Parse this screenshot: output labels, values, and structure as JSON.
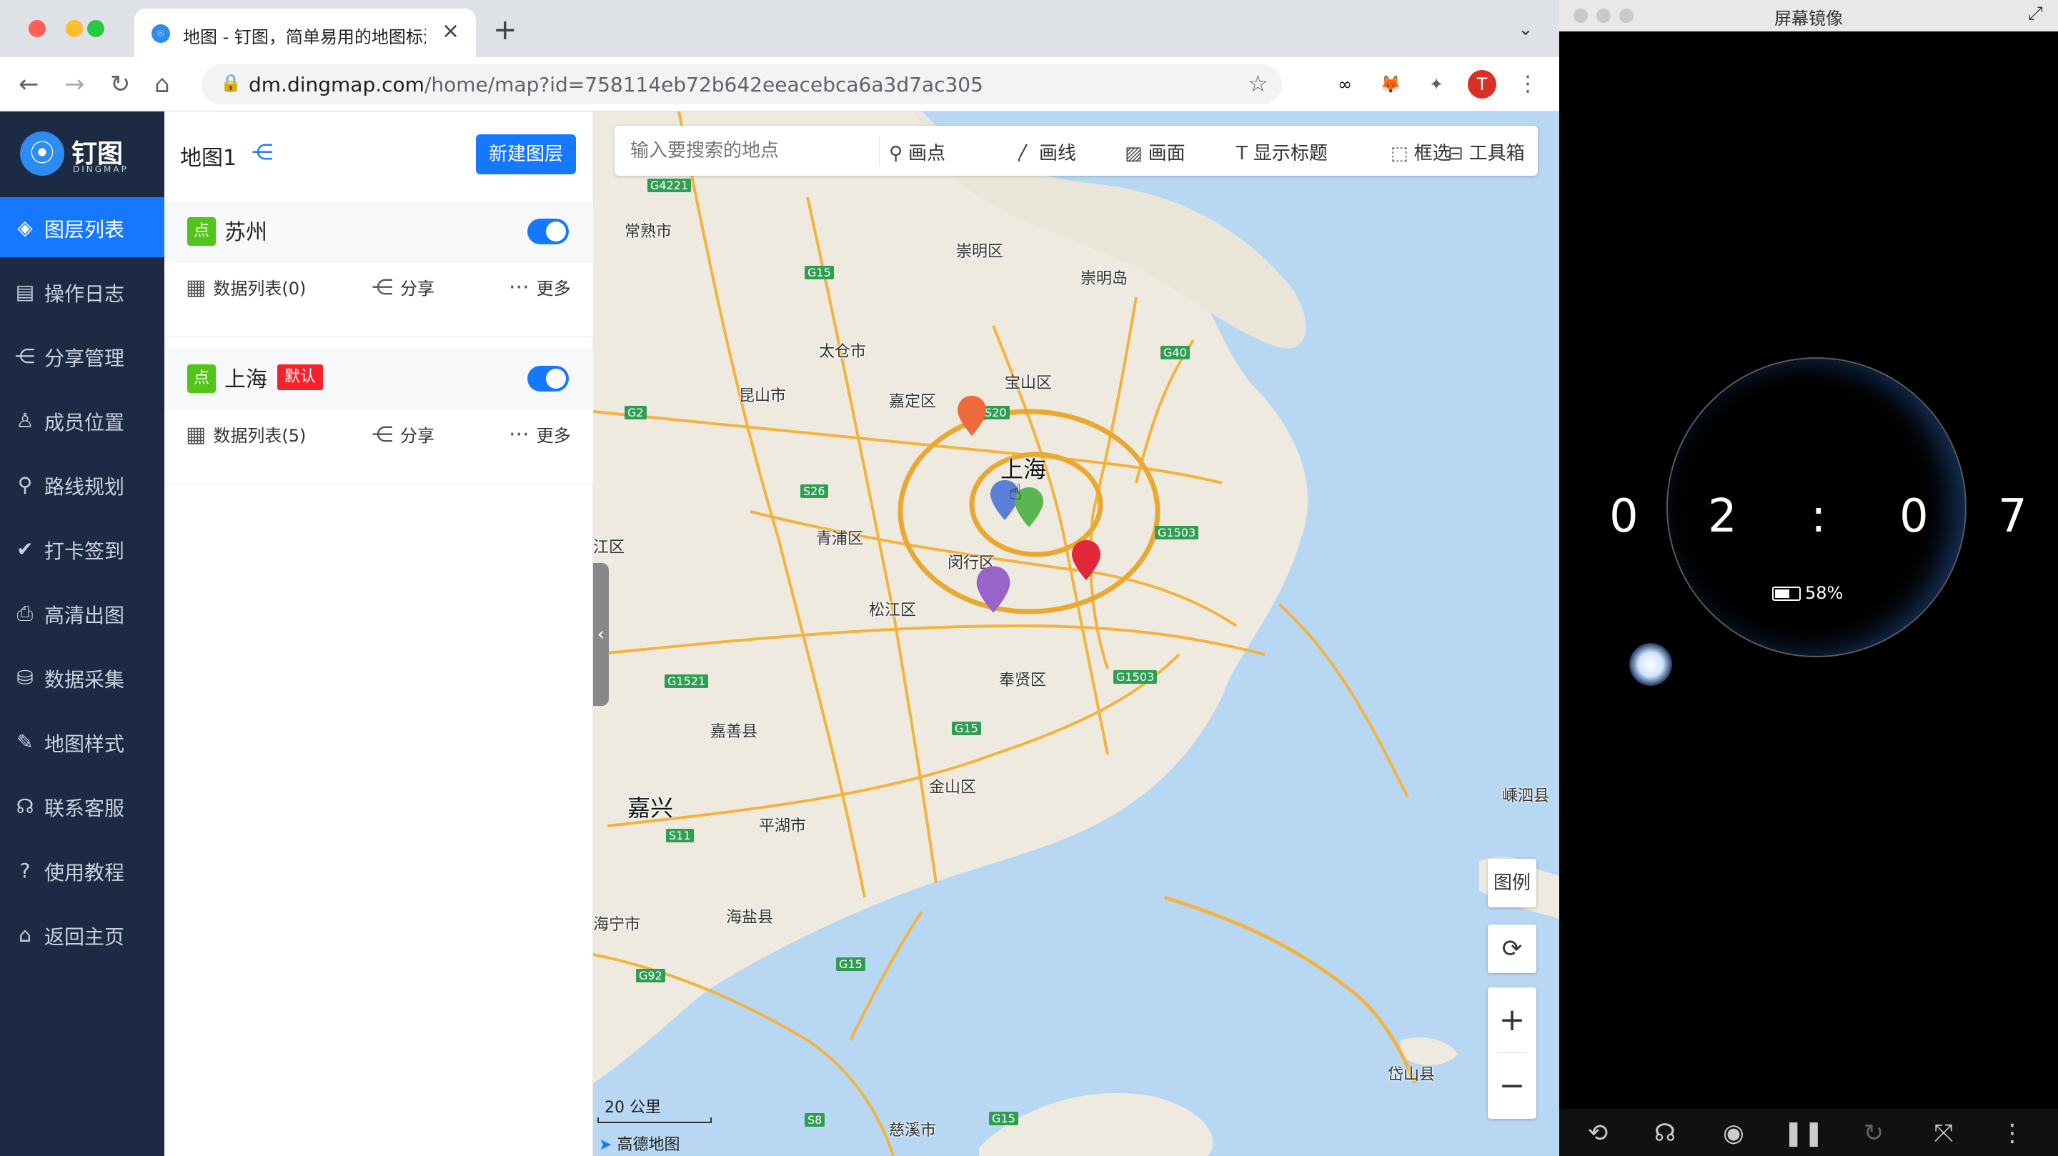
{
  "browser": {
    "tab_title": "地图 - 钉图，简单易用的地图标注",
    "url_host": "dm.dingmap.com",
    "url_path": "/home/map?id=758114eb72b642eeacebca6a3d7ac305",
    "profile_initial": "T"
  },
  "app": {
    "logo_text": "钉图",
    "logo_sub": "DINGMAP",
    "nav": [
      {
        "label": "图层列表"
      },
      {
        "label": "操作日志"
      },
      {
        "label": "分享管理"
      },
      {
        "label": "成员位置"
      },
      {
        "label": "路线规划"
      },
      {
        "label": "打卡签到"
      },
      {
        "label": "高清出图"
      },
      {
        "label": "数据采集"
      },
      {
        "label": "地图样式"
      },
      {
        "label": "联系客服"
      },
      {
        "label": "使用教程"
      },
      {
        "label": "返回主页"
      }
    ]
  },
  "panel": {
    "title": "地图1",
    "new_layer": "新建图层",
    "layers": [
      {
        "badge": "点",
        "name": "苏州",
        "default": "",
        "data_list": "数据列表(0)",
        "share": "分享",
        "more": "更多"
      },
      {
        "badge": "点",
        "name": "上海",
        "default": "默认",
        "data_list": "数据列表(5)",
        "share": "分享",
        "more": "更多"
      }
    ]
  },
  "map": {
    "search_placeholder": "输入要搜索的地点",
    "tools": {
      "point": "画点",
      "line": "画线",
      "area": "画面",
      "title": "显示标题",
      "select": "框选",
      "toolbox": "工具箱"
    },
    "legend": "图例",
    "scale": "20 公里",
    "provider": "高德地图",
    "places": {
      "changshu": "常熟市",
      "chongming": "崇明区",
      "chongmingdao": "崇明岛",
      "taicang": "太仓市",
      "baoshan": "宝山区",
      "kunshan": "昆山市",
      "jiading": "嘉定区",
      "shanghai": "上海",
      "qingpu": "青浦区",
      "minhang": "闵行区",
      "songjiang": "松江区",
      "fengxian": "奉贤区",
      "jiashan": "嘉善县",
      "jiaxing": "嘉兴",
      "jinshan": "金山区",
      "pinghu": "平湖市",
      "haiyan": "海盐县",
      "haining": "海宁市",
      "cixi": "慈溪市",
      "daishan": "岱山县",
      "shengsi": "嵊泗县",
      "wujiang": "江区"
    },
    "roads": {
      "g4221": "G4221",
      "g15a": "G15",
      "g40": "G40",
      "g2": "G2",
      "s20": "S20",
      "s26": "S26",
      "g1503a": "G1503",
      "g1521": "G1521",
      "g1503b": "G1503",
      "g15b": "G15",
      "s11": "S11",
      "g92": "G92",
      "g15c": "G15",
      "s8": "S8",
      "g15d": "G15"
    },
    "colors": {
      "orange": "#ee6a3a",
      "blue": "#5b7fd6",
      "green": "#5ab552",
      "red": "#e0283a",
      "purple": "#9a63c9"
    }
  },
  "mirror": {
    "title": "屏幕镜像",
    "digits": [
      "0",
      "2",
      ":",
      "0",
      "7"
    ],
    "battery": "58%"
  }
}
